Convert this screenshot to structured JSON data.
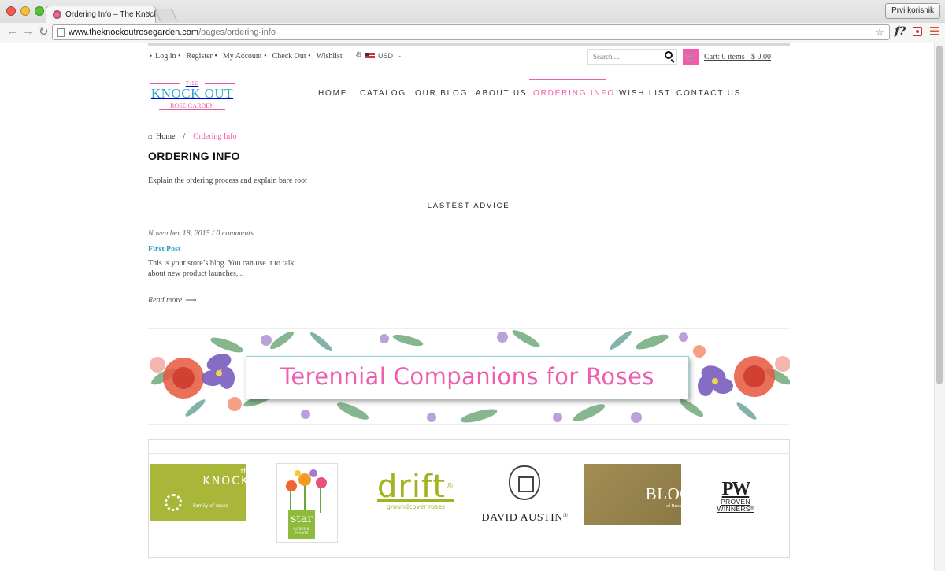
{
  "browser": {
    "tab_title": "Ordering Info – The Knock",
    "tab_close": "×",
    "url_host": "www.theknockoutrosegarden.com",
    "url_path": "/pages/ordering-info",
    "user_button": "Prvi korisnik",
    "back": "←",
    "forward": "→",
    "reload": "↻",
    "star": "☆",
    "ext_f": "f?"
  },
  "topbar": {
    "links": [
      "Log in",
      "Register",
      "My Account",
      "Check Out",
      "Wishlist"
    ],
    "dot": "•",
    "currency": "USD",
    "currency_caret": "⌄",
    "search_placeholder": "Search ...",
    "cart_text": "Cart: 0  items - $ 0.00",
    "cart_icon": "shopping-cart-icon",
    "cart_glyph": "🛒",
    "cog_glyph": "⚙"
  },
  "logo": {
    "the": "THE",
    "main": "KNOCK OUT",
    "sub": "ROSE GARDEN"
  },
  "nav": {
    "items": [
      "HOME",
      "CATALOG",
      "OUR BLOG",
      "ABOUT US",
      "ORDERING INFO",
      "WISH LIST",
      "CONTACT US"
    ],
    "active": "ORDERING INFO"
  },
  "breadcrumb": {
    "home": "Home",
    "home_glyph": "⌂",
    "separator": "/",
    "current": "Ordering Info"
  },
  "page": {
    "title": "ORDERING INFO",
    "intro": "Explain the ordering process and explain bare root",
    "section_title": "LASTEST ADVICE"
  },
  "post": {
    "meta": "November 18, 2015 / 0 comments",
    "title": "First Post",
    "excerpt": "This is your store’s blog. You can use it to talk about new product launches,...",
    "read_more": "Read more",
    "arrow": "⟶"
  },
  "banner": {
    "title": "Terennial Companions for Roses"
  },
  "brands": {
    "knockout": {
      "the": "the",
      "name": "KNOCK OUT",
      "registered": "®",
      "sub": "Family of roses"
    },
    "star": {
      "name": "star",
      "sub": "ROSES & PLANTS"
    },
    "drift": {
      "name": "drift",
      "registered": "®",
      "sub": "groundcover roses"
    },
    "david_austin": {
      "name": "DAVID AUSTIN",
      "registered": "®"
    },
    "blooms": {
      "name": "BLOOMS",
      "sub": "of Bressingham"
    },
    "proven_winners": {
      "mark": "PW",
      "line1": "PROVEN",
      "line2": "WINNERS",
      "registered": "®"
    }
  },
  "colors": {
    "accent_pink": "#f25ba7",
    "logo_blue": "#2fa4c6",
    "knockout_green": "#a8b63a",
    "drift_green": "#a2b322",
    "blooms_gold": "#a38d54"
  }
}
